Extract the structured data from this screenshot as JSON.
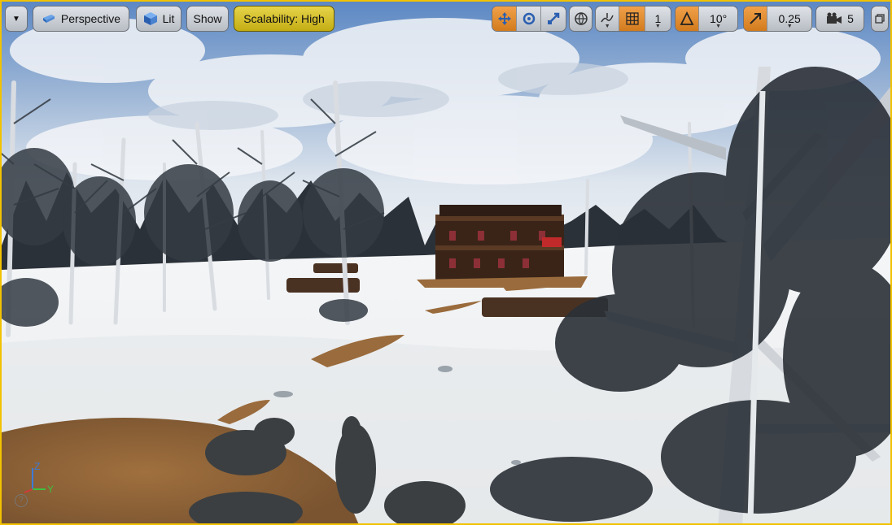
{
  "toolbar": {
    "perspective_label": "Perspective",
    "lit_label": "Lit",
    "show_label": "Show",
    "scalability_label": "Scalability: High",
    "grid_snap_value": "1",
    "rotation_snap_value": "10°",
    "scale_snap_value": "0.25",
    "camera_speed_value": "5"
  },
  "axis": {
    "z": "Z",
    "y": "Y",
    "help": "?"
  },
  "colors": {
    "accent_orange": "#d27b1d",
    "accent_yellow": "#c4ad14",
    "border_yellow": "#f2c200"
  },
  "icons": [
    "menu-caret-icon",
    "perspective-cube-icon",
    "lit-cube-icon",
    "translate-icon",
    "rotate-icon",
    "scale-icon",
    "world-icon",
    "surface-snap-icon",
    "grid-icon",
    "angle-icon",
    "scale-arrow-icon",
    "camera-icon",
    "maximize-icon"
  ]
}
